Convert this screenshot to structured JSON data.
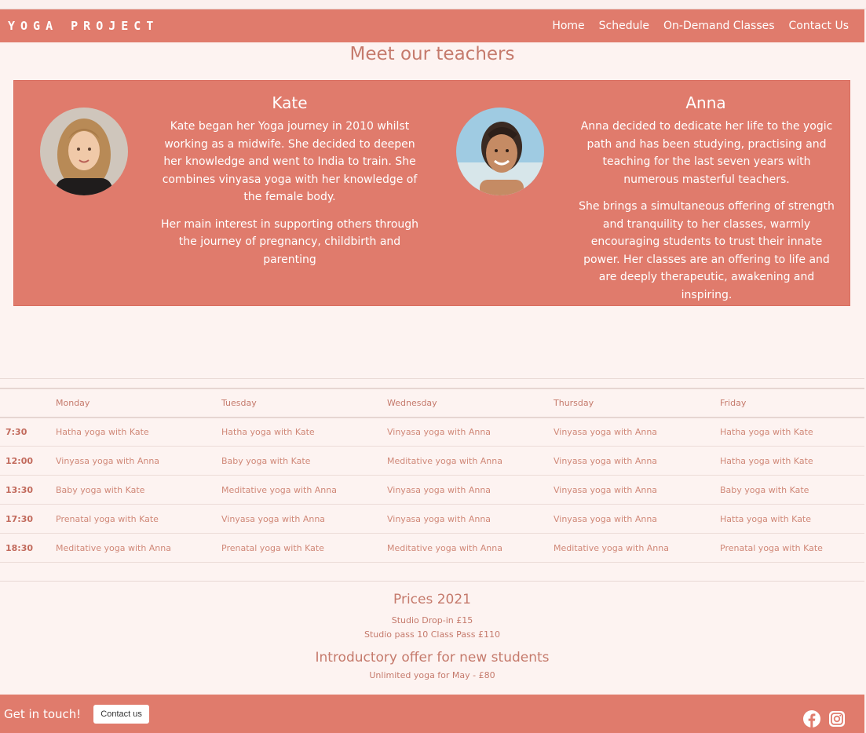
{
  "brand": "YOGA PROJECT",
  "nav": [
    "Home",
    "Schedule",
    "On-Demand Classes",
    "Contact Us"
  ],
  "page_title": "Meet our teachers",
  "teachers": [
    {
      "name": "Kate",
      "bio": [
        "Kate began her Yoga journey in 2010 whilst working as a midwife. She decided to deepen her knowledge and went to India to train. She combines vinyasa yoga with her knowledge of the female body.",
        "Her main interest in supporting others through the journey of pregnancy, childbirth and parenting"
      ]
    },
    {
      "name": "Anna",
      "bio": [
        "Anna decided to dedicate her life to the yogic path and has been studying, practising and teaching for the last seven years with numerous masterful teachers.",
        "She brings a simultaneous offering of strength and tranquility to her classes, warmly encouraging students to trust their innate power. Her classes are an offering to life and are deeply therapeutic, awakening and inspiring."
      ]
    }
  ],
  "schedule": {
    "headers": [
      "",
      "Monday",
      "Tuesday",
      "Wednesday",
      "Thursday",
      "Friday"
    ],
    "rows": [
      [
        "7:30",
        "Hatha yoga with Kate",
        "Hatha yoga with Kate",
        "Vinyasa yoga with Anna",
        "Vinyasa yoga with Anna",
        "Hatha yoga with Kate"
      ],
      [
        "12:00",
        "Vinyasa yoga with Anna",
        "Baby yoga with Kate",
        "Meditative yoga with Anna",
        "Vinyasa yoga with Anna",
        "Hatha yoga with Kate"
      ],
      [
        "13:30",
        "Baby yoga with Kate",
        "Meditative yoga with Anna",
        "Vinyasa yoga with Anna",
        "Vinyasa yoga with Anna",
        "Baby yoga with Kate"
      ],
      [
        "17:30",
        "Prenatal yoga with Kate",
        "Vinyasa yoga with Anna",
        "Vinyasa yoga with Anna",
        "Vinyasa yoga with Anna",
        "Hatta yoga with Kate"
      ],
      [
        "18:30",
        "Meditative yoga with Anna",
        "Prenatal yoga with Kate",
        "Meditative yoga with Anna",
        "Meditative yoga with Anna",
        "Prenatal yoga with Kate"
      ]
    ]
  },
  "prices": {
    "title": "Prices 2021",
    "lines": [
      "Studio Drop-in £15",
      "Studio pass 10 Class Pass £110"
    ],
    "offer_title": "Introductory offer for new students",
    "offer_line": "Unlimited yoga for May - £80"
  },
  "footer": {
    "get_in_touch": "Get in touch!",
    "contact_button": "Contact us",
    "icons": [
      "facebook-icon",
      "instagram-icon"
    ]
  },
  "colors": {
    "accent": "#e07b6c",
    "background": "#fdf3f1",
    "text": "#c57a6c"
  }
}
